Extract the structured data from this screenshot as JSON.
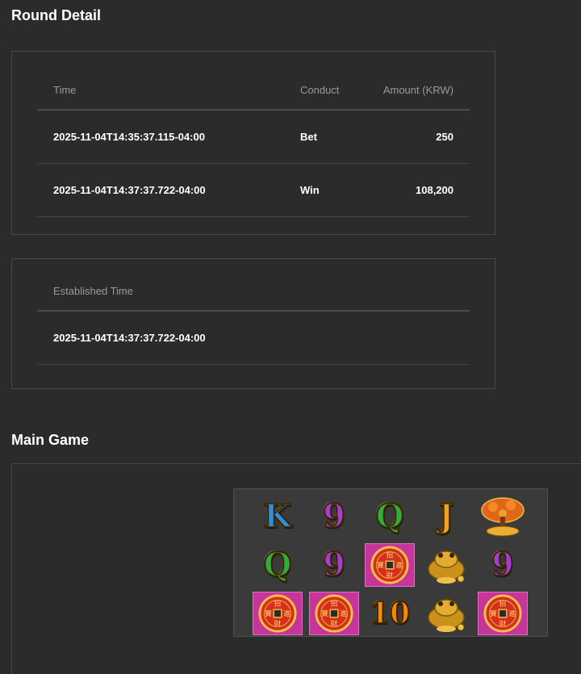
{
  "round_detail": {
    "title": "Round Detail",
    "columns": {
      "time": "Time",
      "conduct": "Conduct",
      "amount": "Amount (KRW)"
    },
    "rows": [
      {
        "time": "2025-11-04T14:35:37.115-04:00",
        "conduct": "Bet",
        "amount": "250"
      },
      {
        "time": "2025-11-04T14:37:37.722-04:00",
        "conduct": "Win",
        "amount": "108,200"
      }
    ]
  },
  "established": {
    "header": "Established Time",
    "value": "2025-11-04T14:37:37.722-04:00"
  },
  "main_game": {
    "title": "Main Game",
    "grid": [
      [
        "K",
        "9",
        "Q",
        "J",
        "money-tree"
      ],
      [
        "Q",
        "9",
        "coin",
        "toad",
        "9"
      ],
      [
        "coin",
        "coin",
        "10",
        "toad",
        "coin"
      ]
    ],
    "coin_chars": {
      "top": "招",
      "left": "寶",
      "right": "進",
      "bottom": "財"
    }
  },
  "colors": {
    "background": "#2b2b2b",
    "k_blue": "#2e8fe0",
    "nine_purple": "#a43cd6",
    "q_green": "#2fae3e",
    "j_gold": "#f0a21a",
    "ten_orange": "#f08a12",
    "coin_tile_pink": "#c8359a"
  }
}
